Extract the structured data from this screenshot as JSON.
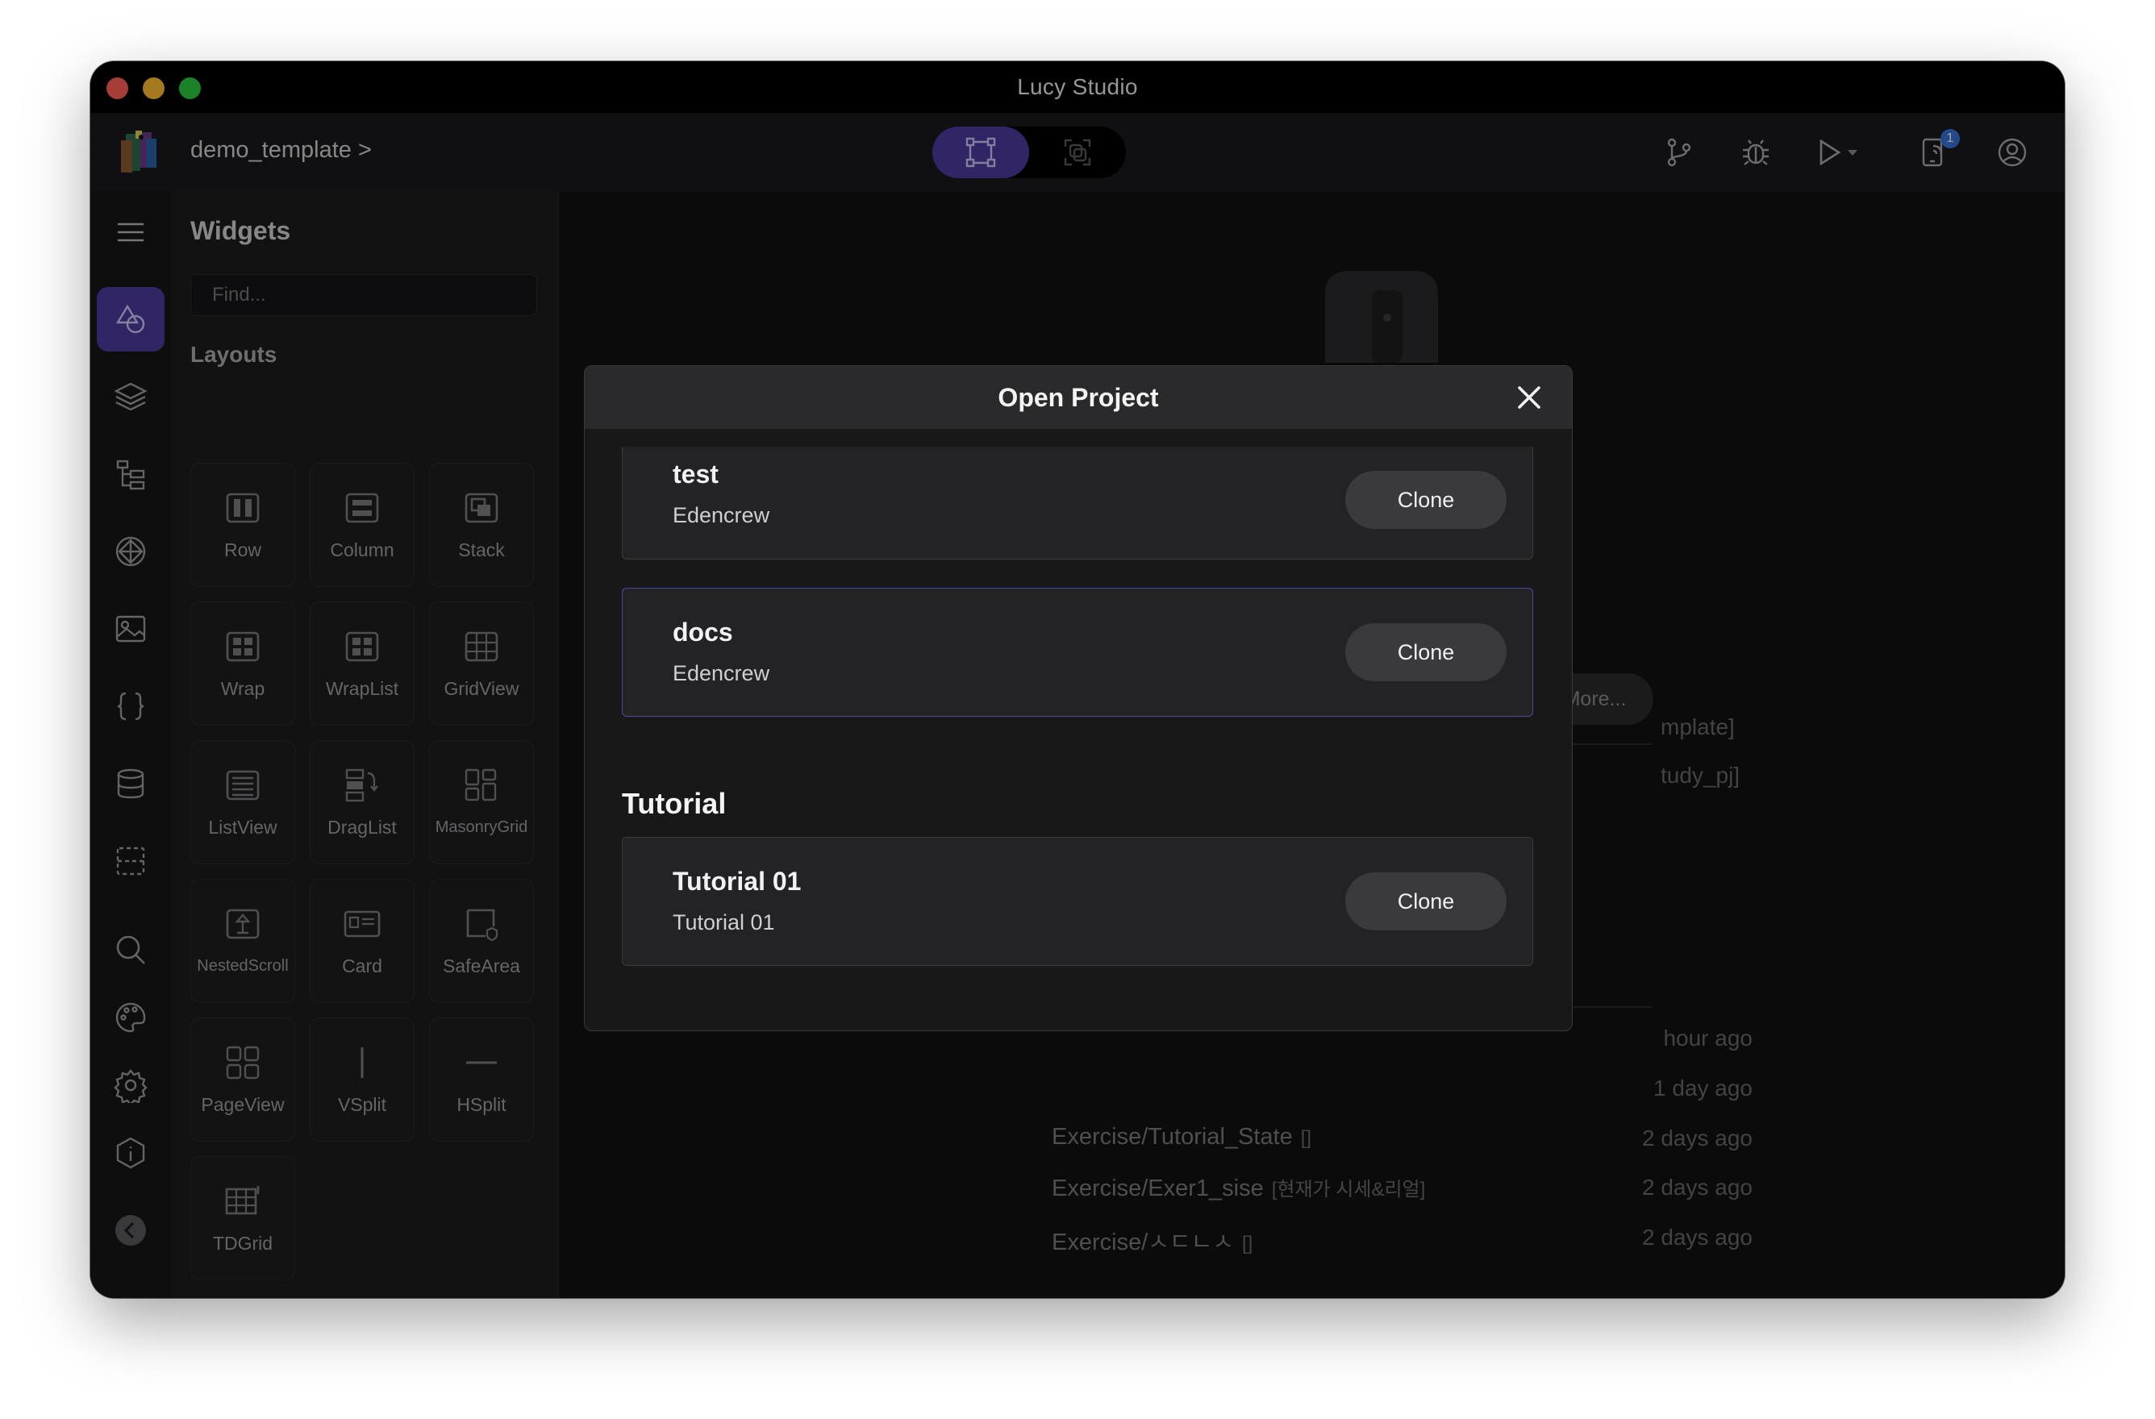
{
  "window": {
    "title": "Lucy Studio"
  },
  "appbar": {
    "project_name": "demo_template >",
    "notification_count": "1",
    "icons": [
      "git-branch-icon",
      "bug-icon",
      "play-icon",
      "device-icon",
      "account-icon"
    ]
  },
  "rail": {
    "items": [
      "menu-icon",
      "widgets-icon",
      "layers-icon",
      "tree-icon",
      "components-icon",
      "image-icon",
      "code-icon",
      "database-icon",
      "dashed-select-icon",
      "search-icon",
      "palette-icon",
      "settings-icon",
      "info-icon",
      "collapse-icon"
    ]
  },
  "panel": {
    "title": "Widgets",
    "search_placeholder": "Find...",
    "section": "Layouts",
    "widgets": [
      {
        "label": "Row",
        "icon": "row-icon"
      },
      {
        "label": "Column",
        "icon": "column-icon"
      },
      {
        "label": "Stack",
        "icon": "stack-icon"
      },
      {
        "label": "Wrap",
        "icon": "wrap-icon"
      },
      {
        "label": "WrapList",
        "icon": "wraplist-icon"
      },
      {
        "label": "GridView",
        "icon": "gridview-icon"
      },
      {
        "label": "ListView",
        "icon": "listview-icon"
      },
      {
        "label": "DragList",
        "icon": "draglist-icon"
      },
      {
        "label": "MasonryGrid",
        "icon": "masonrygrid-icon"
      },
      {
        "label": "NestedScroll",
        "icon": "nestedscroll-icon"
      },
      {
        "label": "Card",
        "icon": "card-icon"
      },
      {
        "label": "SafeArea",
        "icon": "safearea-icon"
      },
      {
        "label": "PageView",
        "icon": "pageview-icon"
      },
      {
        "label": "VSplit",
        "icon": "vsplit-icon"
      },
      {
        "label": "HSplit",
        "icon": "hsplit-icon"
      },
      {
        "label": "TDGrid",
        "icon": "tdgrid-icon"
      }
    ]
  },
  "background": {
    "more_label": "More...",
    "partial_texts": [
      "mplate]",
      "tudy_pj]"
    ],
    "recent": [
      {
        "path": "",
        "tag": "",
        "time": "hour ago"
      },
      {
        "path": "",
        "tag": "",
        "time": "1 day ago"
      },
      {
        "path": "Exercise/Tutorial_State",
        "tag": "[]",
        "time": "2 days ago"
      },
      {
        "path": "Exercise/Exer1_sise",
        "tag": "[현재가 시세&리얼]",
        "time": "2 days ago"
      },
      {
        "path": "Exercise/ㅅㄷㄴㅅ",
        "tag": "[]",
        "time": "2 days ago"
      }
    ]
  },
  "modal": {
    "title": "Open Project",
    "projects": [
      {
        "name": "test",
        "owner": "Edencrew",
        "button": "Clone"
      },
      {
        "name": "docs",
        "owner": "Edencrew",
        "button": "Clone"
      }
    ],
    "section_title": "Tutorial",
    "tutorials": [
      {
        "name": "Tutorial 01",
        "owner": "Tutorial 01",
        "button": "Clone"
      }
    ]
  },
  "colors": {
    "accent": "#4c3a9c",
    "background": "#111113",
    "panel": "#1c1c1e"
  }
}
